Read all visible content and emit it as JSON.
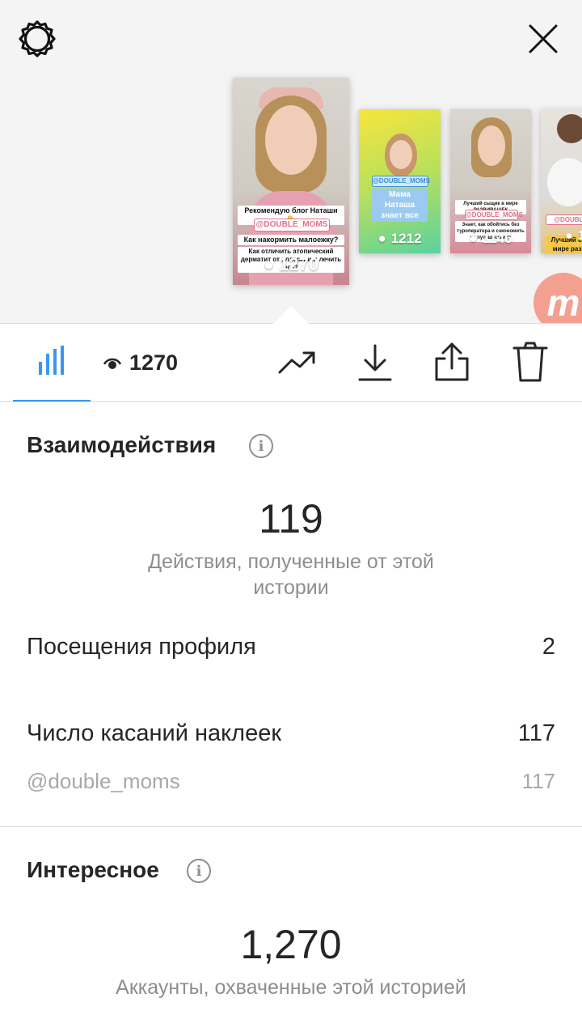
{
  "header": {
    "settings_icon": "gear-icon",
    "close_icon": "close-icon"
  },
  "stories": [
    {
      "views": "1270",
      "caption1": "Рекомендую блог Наташи 👇",
      "tag": "@DOUBLE_MOMS",
      "caption2": "Как накормить малоежку?",
      "caption3": "Как отличить атопический дерматит от аллергии и лечить его?"
    },
    {
      "views": "1212",
      "tag": "@DOUBLE_MOMS",
      "caption1": "Мама Наташа знает все"
    },
    {
      "views": "1146",
      "caption1": "Лучший сыщик в мире РАЗВИВАШЕК",
      "tag": "@DOUBLE_MOMS",
      "caption2": "Знает, как обойтись без туроператора и сэкономить на путешествиях"
    },
    {
      "views": "1",
      "caption1": "Лучший сы",
      "tag": "@DOUBLE",
      "caption2": "мире разв"
    }
  ],
  "badge": {
    "letter": "m"
  },
  "toolbar": {
    "views": "1270",
    "insights_icon": "bar-chart-icon",
    "eye_icon": "eye-icon",
    "promote_icon": "trending-up-icon",
    "download_icon": "download-icon",
    "share_icon": "share-icon",
    "delete_icon": "trash-icon"
  },
  "interactions": {
    "title": "Взаимодействия",
    "total": "119",
    "total_label": "Действия, полученные от этой истории",
    "rows": [
      {
        "label": "Посещения профиля",
        "value": "2"
      },
      {
        "label": "Число касаний наклеек",
        "value": "117"
      },
      {
        "label": "@double_moms",
        "value": "117"
      }
    ]
  },
  "discovery": {
    "title": "Интересное",
    "total": "1,270",
    "total_label": "Аккаунты, охваченные этой историей"
  },
  "colors": {
    "accent": "#3897f0",
    "divider": "#dbdbdb",
    "muted": "#8e8e8e"
  }
}
